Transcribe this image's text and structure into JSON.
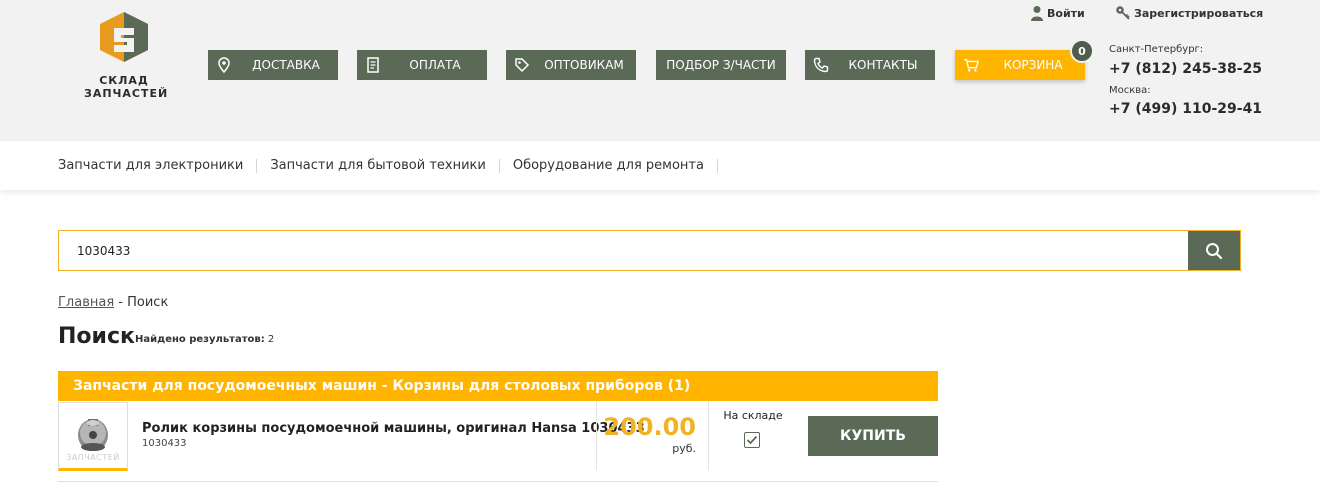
{
  "header": {
    "logo": {
      "line1": "СКЛАД",
      "line2": "ЗАПЧАСТЕЙ"
    },
    "nav": [
      {
        "label": "ДОСТАВКА",
        "icon": "location-pin-icon"
      },
      {
        "label": "ОПЛАТА",
        "icon": "document-icon"
      },
      {
        "label": "ОПТОВИКАМ",
        "icon": "tag-icon"
      },
      {
        "label": "ПОДБОР З/ЧАСТИ",
        "icon": ""
      },
      {
        "label": "КОНТАКТЫ",
        "icon": "phone-icon"
      }
    ],
    "cart": {
      "label": "КОРЗИНА",
      "count": "0",
      "icon": "cart-icon"
    },
    "auth": {
      "login": "Войти",
      "register": "Зарегистрироваться"
    },
    "contacts": [
      {
        "city": "Санкт-Петербург:",
        "phone": "+7 (812) 245-38-25"
      },
      {
        "city": "Москва:",
        "phone": "+7 (499) 110-29-41"
      }
    ],
    "colors": {
      "nav": "#5a6a56",
      "accent": "#ffb400"
    }
  },
  "categories": [
    "Запчасти для электроники",
    "Запчасти для бытовой техники",
    "Оборудование для ремонта"
  ],
  "search": {
    "value": "1030433"
  },
  "breadcrumb": {
    "home": "Главная",
    "separator": " - ",
    "current": "Поиск"
  },
  "page": {
    "title": "Поиск",
    "found_label": "Найдено результатов:",
    "found_count": "2"
  },
  "results": {
    "group_title": "Запчасти для посудомоечных машин - Корзины для столовых приборов (1)",
    "product": {
      "name": "Ролик корзины посудомоечной машины, оригинал Hansa 1030433",
      "code": "1030433",
      "thumb_caption": "ЗАПЧАСТЕЙ",
      "price": "200.00",
      "currency": "руб.",
      "stock_label": "На складе",
      "in_stock": true,
      "buy_label": "КУПИТЬ"
    }
  }
}
